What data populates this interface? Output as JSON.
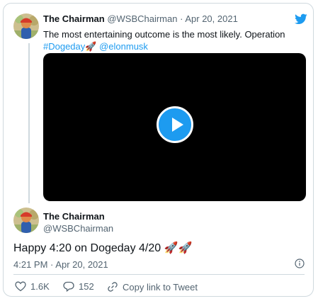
{
  "quoted_tweet": {
    "display_name": "The Chairman",
    "handle": "@WSBChairman",
    "separator": "·",
    "date": "Apr 20, 2021",
    "text_plain": "The most entertaining outcome is the most likely. Operation",
    "hashtag": "#Dogeday",
    "hashtag_emoji": "🚀",
    "mention": "@elonmusk"
  },
  "main_tweet": {
    "display_name": "The Chairman",
    "handle": "@WSBChairman",
    "text": "Happy 4:20 on Dogeday 4/20 🚀🚀",
    "time": "4:21 PM",
    "separator": "·",
    "date": "Apr 20, 2021"
  },
  "actions": {
    "likes": "1.6K",
    "replies": "152",
    "copy_link": "Copy link to Tweet"
  },
  "icons": {
    "brand": "twitter-bird-icon",
    "play": "play-icon",
    "info": "info-icon",
    "like": "heart-icon",
    "reply": "reply-icon",
    "link": "link-icon"
  },
  "colors": {
    "accent": "#1d9bf0",
    "text": "#0f1419",
    "muted": "#536471",
    "border": "#cfd9de"
  }
}
